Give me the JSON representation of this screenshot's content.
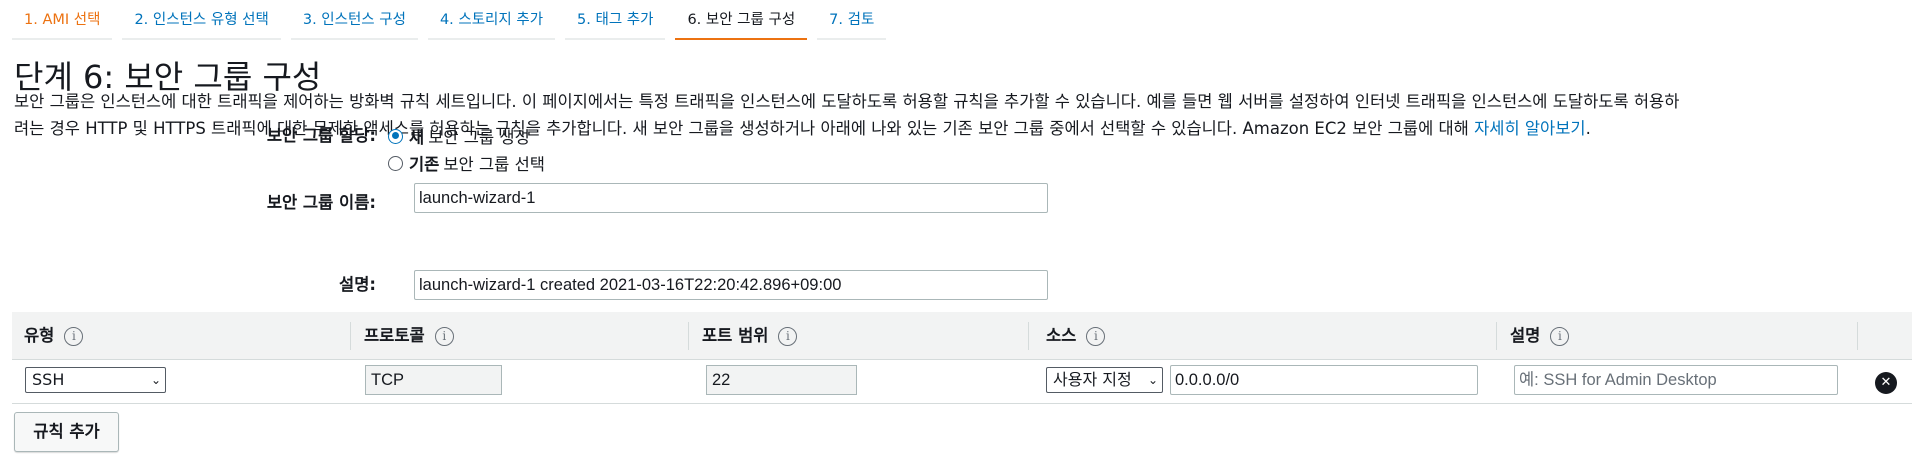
{
  "steps": [
    {
      "label": "1. AMI 선택",
      "state": "done"
    },
    {
      "label": "2. 인스턴스 유형 선택",
      "state": "link"
    },
    {
      "label": "3. 인스턴스 구성",
      "state": "link"
    },
    {
      "label": "4. 스토리지 추가",
      "state": "link"
    },
    {
      "label": "5. 태그 추가",
      "state": "link"
    },
    {
      "label": "6. 보안 그룹 구성",
      "state": "active"
    },
    {
      "label": "7. 검토",
      "state": "link"
    }
  ],
  "page_title": "단계 6: 보안 그룹 구성",
  "description": {
    "line1": "보안 그룹은 인스턴스에 대한 트래픽을 제어하는 방화벽 규칙 세트입니다. 이 페이지에서는 특정 트래픽을 인스턴스에 도달하도록 허용할 규칙을 추가할 수 있습니다. 예를 들면 웹 서버를 설정하여 인터넷 트래픽을 인스턴스에 도달하도록 허용하",
    "line2": "려는 경우 HTTP 및 HTTPS 트래픽에 대한 무제한 액세스를 허용하는 규칙을 추가합니다. 새 보안 그룹을 생성하거나 아래에 나와 있는 기존 보안 그룹 중에서 선택할 수 있습니다. Amazon EC2 보안 그룹에 대해 ",
    "link": "자세히 알아보기",
    "end": "."
  },
  "assign": {
    "label": "보안 그룹 할당:",
    "option_new_bold": "새",
    "option_new_rest": "보안 그룹 생성",
    "option_existing_bold": "기존",
    "option_existing_rest": "보안 그룹 선택"
  },
  "group_name": {
    "label": "보안 그룹 이름:",
    "value": "launch-wizard-1"
  },
  "group_desc": {
    "label": "설명:",
    "value": "launch-wizard-1 created 2021-03-16T22:20:42.896+09:00"
  },
  "table": {
    "headers": [
      "유형",
      "프로토콜",
      "포트 범위",
      "소스",
      "설명"
    ],
    "info_glyph": "i",
    "row": {
      "type": "SSH",
      "protocol": "TCP",
      "port": "22",
      "source_select": "사용자 지정",
      "source_value": "0.0.0.0/0",
      "desc_placeholder": "예: SSH for Admin Desktop"
    }
  },
  "remove_glyph": "✕",
  "add_rule": "규칙 추가",
  "colors": {
    "link": "#0073bb",
    "accent": "#ec7211",
    "header_bg": "#f2f3f3"
  }
}
